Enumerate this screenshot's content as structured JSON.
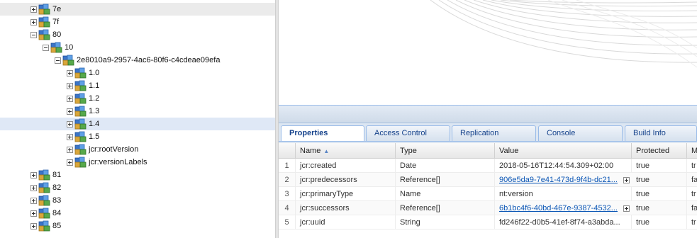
{
  "tree": {
    "nodes": [
      {
        "label": "7e",
        "expanded": false
      },
      {
        "label": "7f",
        "expanded": false
      },
      {
        "label": "80",
        "expanded": true
      },
      {
        "label": "10",
        "expanded": true
      },
      {
        "label": "2e8010a9-2957-4ac6-80f6-c4cdeae09efa",
        "expanded": true
      },
      {
        "label": "1.0",
        "expanded": false
      },
      {
        "label": "1.1",
        "expanded": false
      },
      {
        "label": "1.2",
        "expanded": false
      },
      {
        "label": "1.3",
        "expanded": false
      },
      {
        "label": "1.4",
        "expanded": false,
        "selected": true
      },
      {
        "label": "1.5",
        "expanded": false
      },
      {
        "label": "jcr:rootVersion",
        "expanded": false
      },
      {
        "label": "jcr:versionLabels",
        "expanded": false
      },
      {
        "label": "81",
        "expanded": false
      },
      {
        "label": "82",
        "expanded": false
      },
      {
        "label": "83",
        "expanded": false
      },
      {
        "label": "84",
        "expanded": false
      },
      {
        "label": "85",
        "expanded": false
      }
    ]
  },
  "tabs": [
    {
      "label": "Properties",
      "active": true
    },
    {
      "label": "Access Control"
    },
    {
      "label": "Replication"
    },
    {
      "label": "Console"
    },
    {
      "label": "Build Info"
    }
  ],
  "grid": {
    "columns": [
      "",
      "Name",
      "Type",
      "Value",
      "Protected",
      "M"
    ],
    "sort_indicator": "▲",
    "rows": [
      {
        "num": "1",
        "name": "jcr:created",
        "type": "Date",
        "value": "2018-05-16T12:44:54.309+02:00",
        "link": false,
        "protected": "true",
        "m": "tr"
      },
      {
        "num": "2",
        "name": "jcr:predecessors",
        "type": "Reference[]",
        "value": "906e5da9-7e41-473d-9f4b-dc21...",
        "link": true,
        "protected": "true",
        "m": "fa"
      },
      {
        "num": "3",
        "name": "jcr:primaryType",
        "type": "Name",
        "value": "nt:version",
        "link": false,
        "protected": "true",
        "m": "tr"
      },
      {
        "num": "4",
        "name": "jcr:successors",
        "type": "Reference[]",
        "value": "6b1bc4f6-40bd-467e-9387-4532...",
        "link": true,
        "protected": "true",
        "m": "fa"
      },
      {
        "num": "5",
        "name": "jcr:uuid",
        "type": "String",
        "value": "fd246f22-d0b5-41ef-8f74-a3abda...",
        "link": false,
        "protected": "true",
        "m": "tr"
      }
    ]
  },
  "colors": {
    "tab_text": "#15428b",
    "link": "#0b56b5",
    "selected_row": "#dfe8f6"
  }
}
